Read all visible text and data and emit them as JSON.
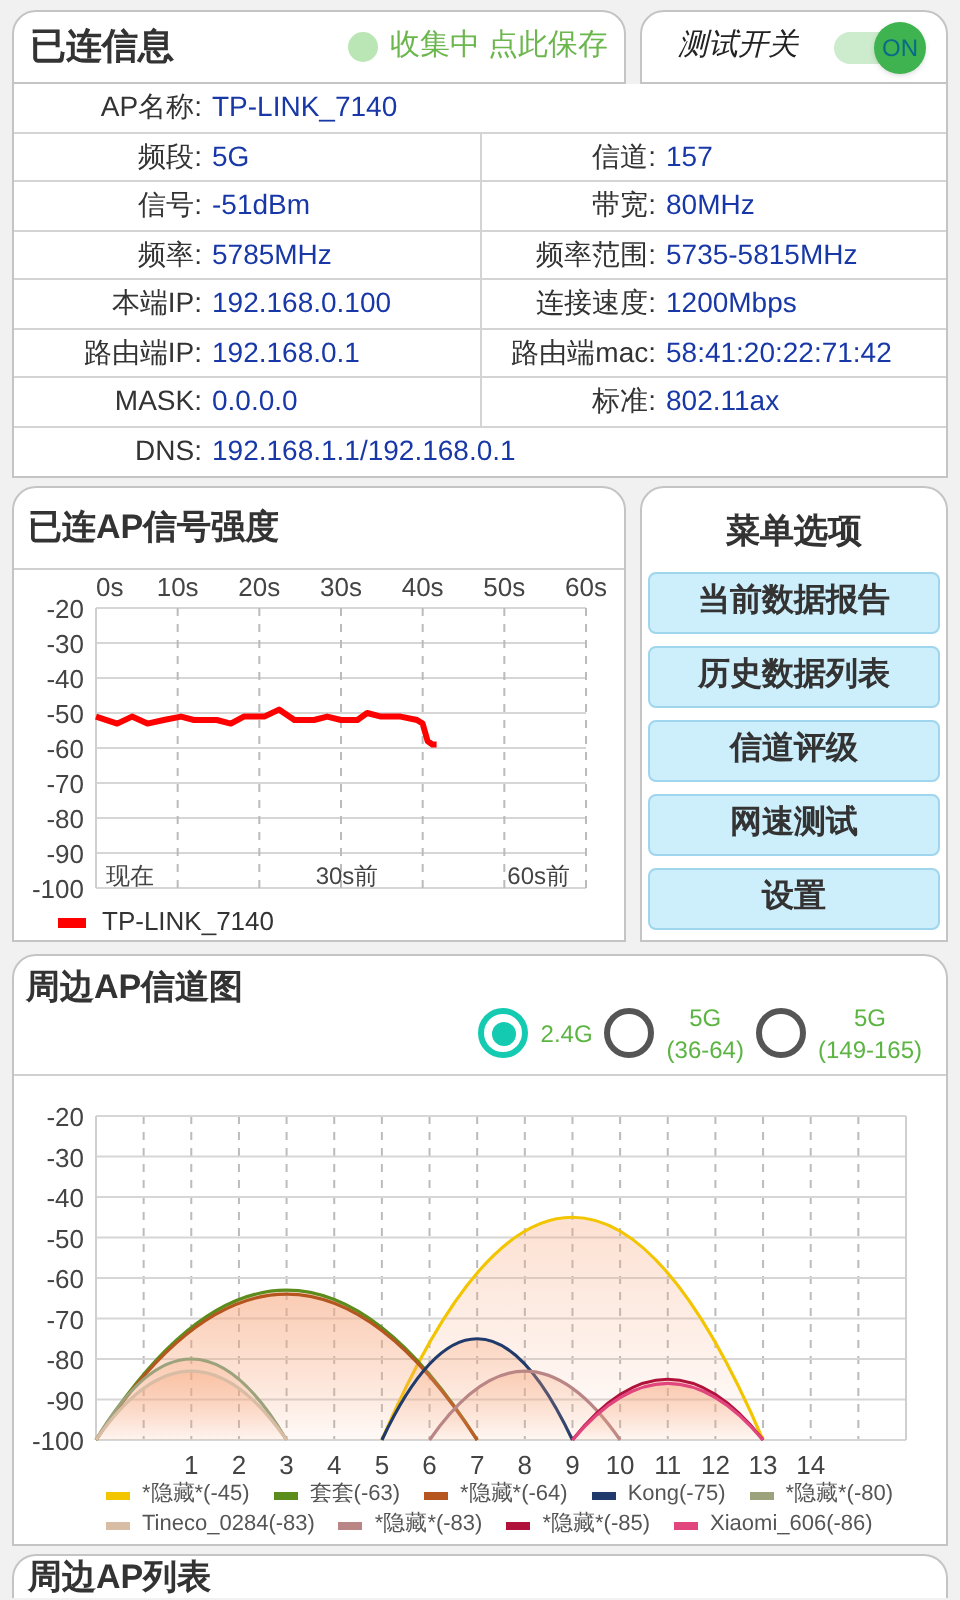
{
  "connected_info": {
    "title": "已连信息",
    "status": {
      "text": "收集中 点此保存",
      "collecting": true
    }
  },
  "test_switch": {
    "label": "测试开关",
    "on": true,
    "knob_text": "ON"
  },
  "info_rows": [
    {
      "cells": [
        {
          "label": "AP名称:",
          "value": "TP-LINK_7140"
        }
      ]
    },
    {
      "cells": [
        {
          "label": "频段:",
          "value": "5G"
        },
        {
          "label": "信道:",
          "value": "157"
        }
      ]
    },
    {
      "cells": [
        {
          "label": "信号:",
          "value": "-51dBm"
        },
        {
          "label": "带宽:",
          "value": "80MHz"
        }
      ]
    },
    {
      "cells": [
        {
          "label": "频率:",
          "value": "5785MHz"
        },
        {
          "label": "频率范围:",
          "value": "5735-5815MHz"
        }
      ]
    },
    {
      "cells": [
        {
          "label": "本端IP:",
          "value": "192.168.0.100"
        },
        {
          "label": "连接速度:",
          "value": "1200Mbps"
        }
      ]
    },
    {
      "cells": [
        {
          "label": "路由端IP:",
          "value": "192.168.0.1"
        },
        {
          "label": "路由端mac:",
          "value": "58:41:20:22:71:42"
        }
      ]
    },
    {
      "cells": [
        {
          "label": "MASK:",
          "value": "0.0.0.0"
        },
        {
          "label": "标准:",
          "value": "802.11ax"
        }
      ]
    },
    {
      "cells": [
        {
          "label": "DNS:",
          "value": "192.168.1.1/192.168.0.1"
        }
      ]
    }
  ],
  "signal_strength": {
    "title": "已连AP信号强度",
    "chart_data": {
      "type": "line",
      "x": [
        0,
        2.6,
        4.4,
        6.3,
        8.3,
        10.4,
        12,
        14.8,
        16.5,
        18.1,
        20.6,
        22.4,
        24.3,
        26.7,
        28.3,
        30,
        32,
        33.2,
        34.9,
        37.3,
        39.3,
        40,
        40.6,
        41.2,
        41.7
      ],
      "series": [
        {
          "name": "TP-LINK_7140",
          "color": "#ff0000",
          "values": [
            -51,
            -53,
            -51,
            -53,
            -52,
            -51,
            -52,
            -52,
            -53,
            -51,
            -51,
            -49,
            -52,
            -52,
            -51,
            -52,
            -52,
            -50,
            -51,
            -51,
            -52,
            -53,
            -58,
            -59,
            -59
          ]
        }
      ],
      "xlim": [
        0,
        60
      ],
      "ylim": [
        -100,
        -20
      ],
      "xticks": [
        {
          "value": 0,
          "label": "0s"
        },
        {
          "value": 10,
          "label": "10s"
        },
        {
          "value": 20,
          "label": "20s"
        },
        {
          "value": 30,
          "label": "30s"
        },
        {
          "value": 40,
          "label": "40s"
        },
        {
          "value": 50,
          "label": "50s"
        },
        {
          "value": 60,
          "label": "60s"
        }
      ],
      "yticks": [
        -20,
        -30,
        -40,
        -50,
        -60,
        -70,
        -80,
        -90,
        -100
      ],
      "grid": true,
      "annotations": [
        "现在",
        "30s前",
        "60s前"
      ]
    }
  },
  "menu": {
    "title": "菜单选项",
    "items": [
      "当前数据报告",
      "历史数据列表",
      "信道评级",
      "网速测试",
      "设置"
    ]
  },
  "channel_map": {
    "title": "周边AP信道图",
    "bands": [
      {
        "label": "2.4G",
        "selected": true
      },
      {
        "label": "5G\n(36-64)",
        "selected": false
      },
      {
        "label": "5G\n(149-165)",
        "selected": false
      }
    ],
    "chart_data": {
      "type": "line",
      "grid": true,
      "legend": "bottom",
      "x": [
        -1,
        0,
        1,
        2,
        3,
        4,
        5,
        6,
        7,
        8,
        9,
        10,
        11,
        12,
        13
      ],
      "series": [
        {
          "name": "*隐藏*(-45)",
          "color": "#f2c500",
          "values": [
            null,
            null,
            null,
            null,
            null,
            null,
            -100,
            null,
            null,
            null,
            -45,
            null,
            null,
            null,
            -100
          ]
        },
        {
          "name": "套套(-63)",
          "color": "#5b8c1c",
          "values": [
            -100,
            null,
            null,
            null,
            -63,
            null,
            null,
            null,
            -100,
            null,
            null,
            null,
            null,
            null,
            null
          ]
        },
        {
          "name": "*隐藏*(-64)",
          "color": "#b5561e",
          "values": [
            -100,
            null,
            null,
            null,
            -64,
            null,
            null,
            null,
            -100,
            null,
            null,
            null,
            null,
            null,
            null
          ]
        },
        {
          "name": "Kong(-75)",
          "color": "#1f3a6b",
          "values": [
            null,
            null,
            null,
            null,
            null,
            null,
            -100,
            null,
            -75,
            null,
            -100,
            null,
            null,
            null,
            null
          ]
        },
        {
          "name": "*隐藏*(-80)",
          "color": "#9ba27c",
          "values": [
            -100,
            null,
            -80,
            null,
            -100,
            null,
            null,
            null,
            null,
            null,
            null,
            null,
            null,
            null,
            null
          ]
        },
        {
          "name": "Tineco_0284(-83)",
          "color": "#d9bca4",
          "values": [
            -100,
            null,
            -83,
            null,
            -100,
            null,
            null,
            null,
            null,
            null,
            null,
            null,
            null,
            null,
            null
          ]
        },
        {
          "name": "*隐藏*(-83)",
          "color": "#b98585",
          "values": [
            null,
            null,
            null,
            null,
            null,
            null,
            null,
            -100,
            null,
            -83,
            null,
            -100,
            null,
            null,
            null
          ]
        },
        {
          "name": "*隐藏*(-85)",
          "color": "#b0123c",
          "values": [
            null,
            null,
            null,
            null,
            null,
            null,
            null,
            null,
            null,
            null,
            -100,
            null,
            -85,
            null,
            -100
          ]
        },
        {
          "name": "Xiaomi_606(-86)",
          "color": "#e0457e",
          "values": [
            null,
            null,
            null,
            null,
            null,
            null,
            null,
            null,
            null,
            null,
            -100,
            null,
            -86,
            null,
            -100
          ]
        }
      ],
      "xlim": [
        -1,
        16
      ],
      "ylim": [
        -100,
        -20
      ],
      "xticks": [
        1,
        2,
        3,
        4,
        5,
        6,
        7,
        8,
        9,
        10,
        11,
        12,
        13,
        14
      ],
      "yticks": [
        -20,
        -30,
        -40,
        -50,
        -60,
        -70,
        -80,
        -90,
        -100
      ]
    }
  },
  "ap_list": {
    "title": "周边AP列表"
  }
}
